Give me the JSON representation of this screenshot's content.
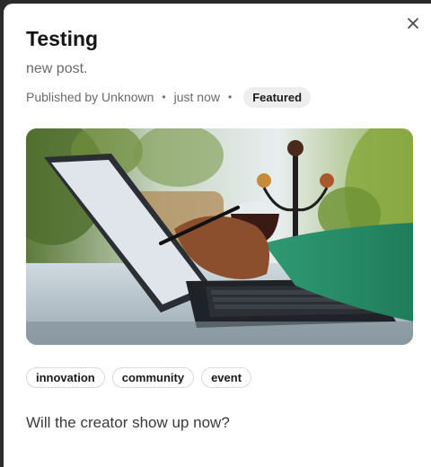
{
  "post": {
    "title": "Testing",
    "subtitle": "new post.",
    "meta": {
      "author": "Published by Unknown",
      "separator": "•",
      "time": "just now",
      "badge": "Featured"
    },
    "image_alt": "Person using a laptop at a table with plants and a glass",
    "tags": [
      "innovation",
      "community",
      "event"
    ],
    "body": "Will the creator show up now?"
  },
  "icons": {
    "close": "close-icon"
  },
  "colors": {
    "title": "#141414",
    "muted": "#6b6b6b",
    "badge_bg": "#eeeeee",
    "tag_border": "#d9d9d9"
  }
}
